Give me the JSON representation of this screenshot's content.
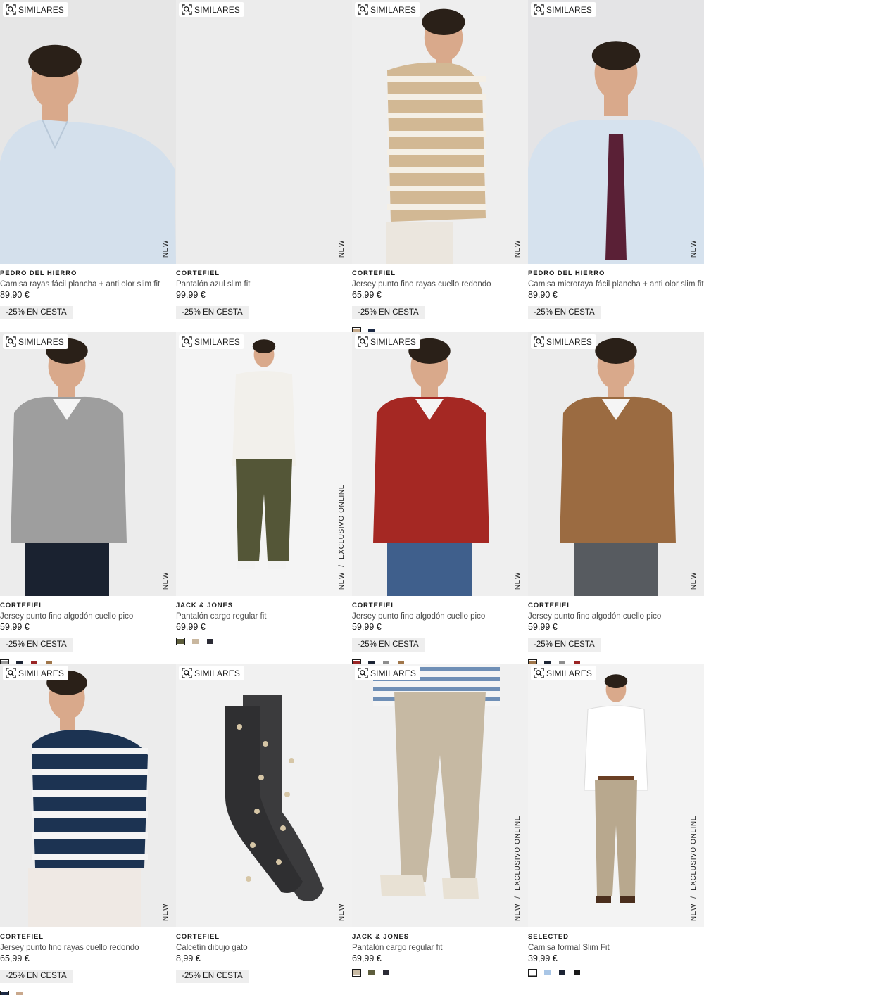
{
  "similar_label": "SIMILARES",
  "products": [
    {
      "brand": "PEDRO DEL HIERRO",
      "name": "Camisa rayas fácil plancha + anti olor slim fit",
      "price": "89,90 €",
      "promo": "-25% EN CESTA",
      "tags": [
        "NEW"
      ],
      "swatches": [],
      "photo": "shirt-portrait",
      "colors": {
        "bg": "#e6e6e6",
        "garment": "#d4e0ec"
      }
    },
    {
      "brand": "CORTEFIEL",
      "name": "Pantalón azul slim fit",
      "price": "99,99 €",
      "promo": "-25% EN CESTA",
      "tags": [
        "NEW"
      ],
      "swatches": [],
      "photo": "trousers",
      "colors": {
        "bg": "#ececec",
        "garment": "#1f2c4d"
      }
    },
    {
      "brand": "CORTEFIEL",
      "name": "Jersey punto fino rayas cuello redondo",
      "price": "65,99 €",
      "promo": "-25% EN CESTA",
      "tags": [
        "NEW"
      ],
      "swatches": [
        "#c4a888",
        "#1c2a45"
      ],
      "selected": 0,
      "photo": "striped-sweater",
      "colors": {
        "bg": "#eeeeee",
        "garment": "#d2b894",
        "stripe": "#f4efe6"
      }
    },
    {
      "brand": "PEDRO DEL HIERRO",
      "name": "Camisa microraya fácil plancha + anti olor slim fit",
      "price": "89,90 €",
      "promo": "-25% EN CESTA",
      "tags": [
        "NEW"
      ],
      "swatches": [],
      "photo": "shirt-tie",
      "colors": {
        "bg": "#e4e4e6",
        "garment": "#d6e2ee",
        "tie": "#5a2036"
      }
    },
    {
      "brand": "CORTEFIEL",
      "name": "Jersey punto fino algodón cuello pico",
      "price": "59,99 €",
      "promo": "-25% EN CESTA",
      "tags": [
        "NEW"
      ],
      "swatches": [
        "#9b9b9b",
        "#1c2434",
        "#9a2424",
        "#a0764a"
      ],
      "selected": 0,
      "photo": "vneck",
      "colors": {
        "bg": "#ececec",
        "garment": "#9e9e9e",
        "legs": "#1a2230"
      }
    },
    {
      "brand": "JACK & JONES",
      "name": "Pantalón cargo regular fit",
      "price": "69,99 €",
      "promo": "",
      "tags": [
        "NEW",
        "EXCLUSIVO ONLINE"
      ],
      "swatches": [
        "#5d5d3c",
        "#c9b79f",
        "#2b2b35"
      ],
      "selected": 0,
      "photo": "cargo-full",
      "colors": {
        "bg": "#f4f4f4",
        "garment": "#f2f0eb",
        "legs": "#545637"
      }
    },
    {
      "brand": "CORTEFIEL",
      "name": "Jersey punto fino algodón cuello pico",
      "price": "59,99 €",
      "promo": "-25% EN CESTA",
      "tags": [
        "NEW"
      ],
      "swatches": [
        "#9a2424",
        "#1c2434",
        "#8d8d8d",
        "#a0764a"
      ],
      "selected": 0,
      "photo": "vneck-red",
      "colors": {
        "bg": "#efefef",
        "garment": "#a52823",
        "legs": "#3f5f8c"
      }
    },
    {
      "brand": "CORTEFIEL",
      "name": "Jersey punto fino algodón cuello pico",
      "price": "59,99 €",
      "promo": "-25% EN CESTA",
      "tags": [
        "NEW"
      ],
      "swatches": [
        "#a0764a",
        "#1c2434",
        "#8d8d8d",
        "#9a2424"
      ],
      "selected": 0,
      "photo": "vneck-brown",
      "colors": {
        "bg": "#ececec",
        "garment": "#9b6b41",
        "legs": "#575b60"
      }
    },
    {
      "brand": "CORTEFIEL",
      "name": "Jersey punto fino rayas cuello redondo",
      "price": "65,99 €",
      "promo": "-25% EN CESTA",
      "tags": [
        "NEW"
      ],
      "swatches": [
        "#1c2a45",
        "#c9a88c"
      ],
      "selected": 0,
      "photo": "striped-navy",
      "colors": {
        "bg": "#ececec",
        "garment": "#1c3352",
        "stripe": "#f4f4f4"
      }
    },
    {
      "brand": "CORTEFIEL",
      "name": "Calcetín dibujo gato",
      "price": "8,99 €",
      "promo": "-25% EN CESTA",
      "tags": [
        "NEW"
      ],
      "swatches": [],
      "photo": "sock",
      "colors": {
        "bg": "#f1f1f1",
        "garment": "#3b3b3d"
      }
    },
    {
      "brand": "JACK & JONES",
      "name": "Pantalón cargo regular fit",
      "price": "69,99 €",
      "promo": "",
      "tags": [
        "NEW",
        "EXCLUSIVO ONLINE"
      ],
      "swatches": [
        "#c9bba4",
        "#5d5d3c",
        "#2b2b35"
      ],
      "selected": 0,
      "photo": "cargo-legs",
      "colors": {
        "bg": "#f0f0f0",
        "garment": "#c6b9a3",
        "stripe": "#6f8fb6"
      }
    },
    {
      "brand": "SELECTED",
      "name": "Camisa formal Slim Fit",
      "price": "39,99 €",
      "promo": "",
      "tags": [
        "NEW",
        "EXCLUSIVO ONLINE"
      ],
      "swatches": [
        "#ffffff",
        "#a9c6e6",
        "#1c2434",
        "#1a1a1a"
      ],
      "selected": 0,
      "photo": "formal-full",
      "colors": {
        "bg": "#f3f3f3",
        "garment": "#ffffff",
        "legs": "#b8a88e"
      }
    }
  ]
}
